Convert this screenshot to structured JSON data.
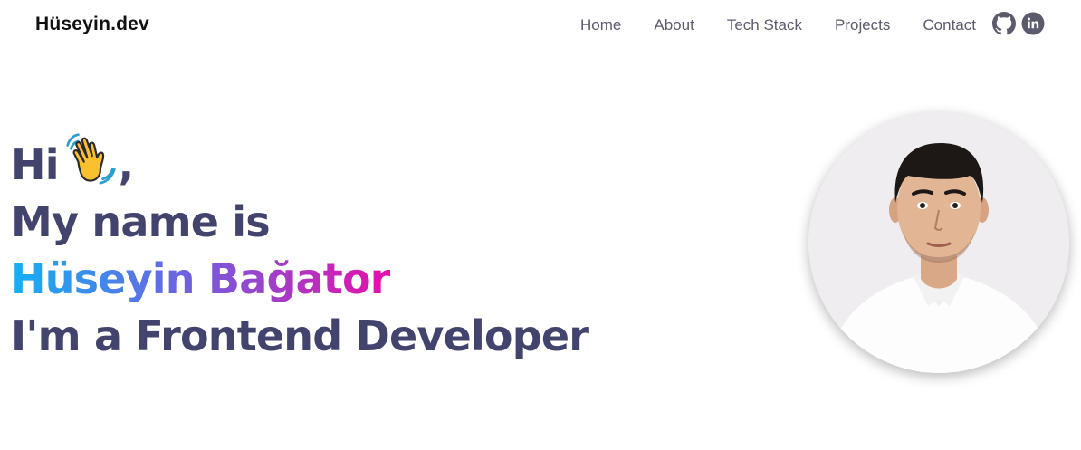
{
  "brand": {
    "logo_text": "Hüseyin.dev"
  },
  "nav": {
    "items": [
      {
        "label": "Home"
      },
      {
        "label": "About"
      },
      {
        "label": "Tech Stack"
      },
      {
        "label": "Projects"
      },
      {
        "label": "Contact"
      }
    ],
    "social": [
      {
        "icon": "github-icon"
      },
      {
        "icon": "linkedin-icon"
      }
    ]
  },
  "hero": {
    "greeting": "Hi",
    "greeting_emoji": "waving-hand-icon",
    "greeting_suffix": ",",
    "intro": "My name is",
    "name": "Hüseyin Bağator",
    "role": "I'm a Frontend Developer"
  },
  "colors": {
    "heading": "#42446e",
    "gradient_start": "#13b0f5",
    "gradient_end": "#e70faa",
    "nav_text": "#5b5b6b"
  }
}
